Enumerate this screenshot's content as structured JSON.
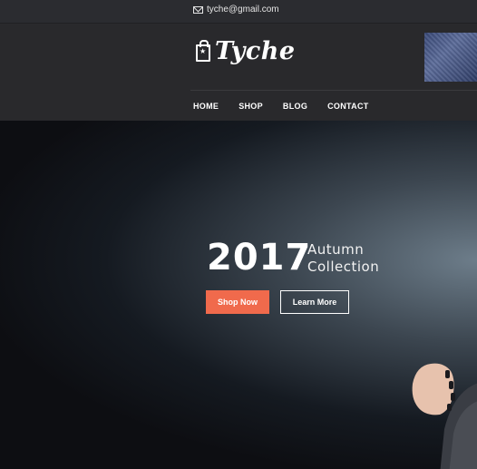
{
  "topbar": {
    "email": "tyche@gmail.com",
    "email_icon": "mail-icon"
  },
  "header": {
    "logo_text": "Tyche",
    "logo_icon": "shopping-bag-icon",
    "nav": [
      {
        "label": "HOME"
      },
      {
        "label": "SHOP"
      },
      {
        "label": "BLOG"
      },
      {
        "label": "CONTACT"
      }
    ]
  },
  "hero": {
    "year": "2017",
    "subtitle_line1": "Autumn",
    "subtitle_line2": "Collection",
    "shop_button": "Shop Now",
    "learn_button": "Learn More"
  },
  "colors": {
    "topbar_bg": "#2b2c30",
    "header_bg": "#29292c",
    "accent": "#f06a4c",
    "hero_bg": "#0d0e11"
  }
}
